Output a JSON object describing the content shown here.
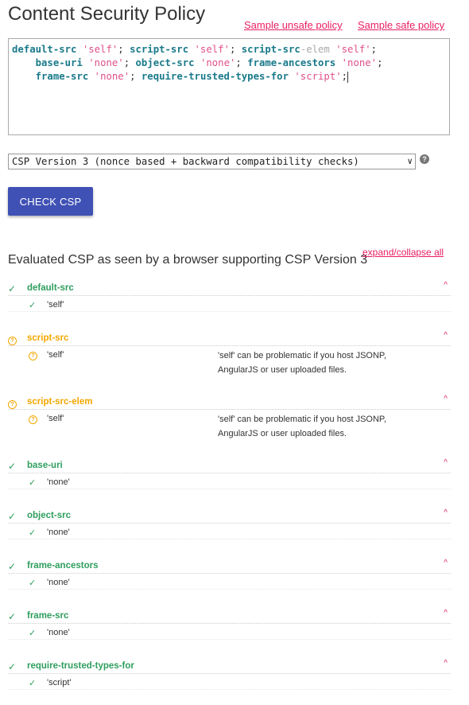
{
  "page": {
    "title": "Content Security Policy",
    "sample_unsafe": "Sample unsafe policy",
    "sample_safe": "Sample safe policy"
  },
  "editor": {
    "lines": [
      [
        {
          "t": "default-src",
          "c": "kw"
        },
        {
          "t": " "
        },
        {
          "t": "'self'",
          "c": "str"
        },
        {
          "t": "; "
        },
        {
          "t": "script-src",
          "c": "kw"
        },
        {
          "t": " "
        },
        {
          "t": "'self'",
          "c": "str"
        },
        {
          "t": "; "
        },
        {
          "t": "script-src",
          "c": "kw"
        },
        {
          "t": "-elem",
          "c": "elem"
        },
        {
          "t": " "
        },
        {
          "t": "'self'",
          "c": "str"
        },
        {
          "t": ";"
        }
      ],
      [
        {
          "t": "    "
        },
        {
          "t": "base-uri",
          "c": "kw"
        },
        {
          "t": " "
        },
        {
          "t": "'none'",
          "c": "str"
        },
        {
          "t": "; "
        },
        {
          "t": "object-src",
          "c": "kw"
        },
        {
          "t": " "
        },
        {
          "t": "'none'",
          "c": "str"
        },
        {
          "t": "; "
        },
        {
          "t": "frame-ancestors",
          "c": "kw"
        },
        {
          "t": " "
        },
        {
          "t": "'none'",
          "c": "str"
        },
        {
          "t": ";"
        }
      ],
      [
        {
          "t": "    "
        },
        {
          "t": "frame-src",
          "c": "kw"
        },
        {
          "t": " "
        },
        {
          "t": "'none'",
          "c": "str"
        },
        {
          "t": "; "
        },
        {
          "t": "require-trusted-types-for",
          "c": "kw"
        },
        {
          "t": " "
        },
        {
          "t": "'script'",
          "c": "str"
        },
        {
          "t": ";"
        }
      ]
    ]
  },
  "version_select": {
    "selected": "CSP Version 3 (nonce based + backward compatibility checks)",
    "chevron": "∨"
  },
  "help_icon": "?",
  "check_button": "CHECK CSP",
  "evaluated_heading": "Evaluated CSP as seen by a browser supporting CSP Version 3",
  "expand_collapse": "expand/collapse all",
  "colors": {
    "ok": "#2e9e5e",
    "warn": "#f2a700",
    "link": "#e91e63",
    "button": "#3f51b5"
  },
  "directives": [
    {
      "name": "default-src",
      "status": "ok",
      "values": [
        {
          "value": "'self'",
          "status": "ok",
          "note": ""
        }
      ]
    },
    {
      "name": "script-src",
      "status": "warn",
      "values": [
        {
          "value": "'self'",
          "status": "warn",
          "note": "'self' can be problematic if you host JSONP, AngularJS or user uploaded files."
        }
      ]
    },
    {
      "name": "script-src-elem",
      "status": "warn",
      "values": [
        {
          "value": "'self'",
          "status": "warn",
          "note": "'self' can be problematic if you host JSONP, AngularJS or user uploaded files."
        }
      ]
    },
    {
      "name": "base-uri",
      "status": "ok",
      "values": [
        {
          "value": "'none'",
          "status": "ok",
          "note": ""
        }
      ]
    },
    {
      "name": "object-src",
      "status": "ok",
      "values": [
        {
          "value": "'none'",
          "status": "ok",
          "note": ""
        }
      ]
    },
    {
      "name": "frame-ancestors",
      "status": "ok",
      "values": [
        {
          "value": "'none'",
          "status": "ok",
          "note": ""
        }
      ]
    },
    {
      "name": "frame-src",
      "status": "ok",
      "values": [
        {
          "value": "'none'",
          "status": "ok",
          "note": ""
        }
      ]
    },
    {
      "name": "require-trusted-types-for",
      "status": "ok",
      "values": [
        {
          "value": "'script'",
          "status": "ok",
          "note": ""
        }
      ]
    }
  ]
}
